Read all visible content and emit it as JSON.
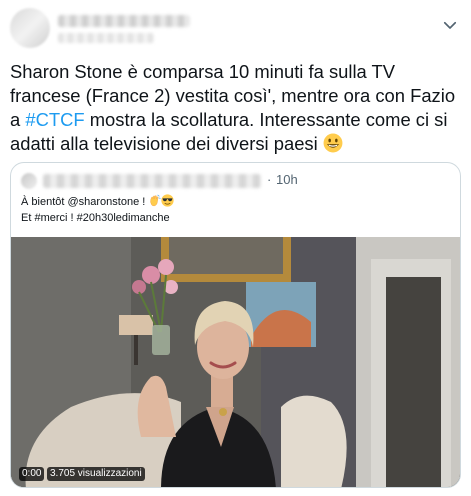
{
  "tweet": {
    "text_1": "Sharon Stone è comparsa 10 minuti fa sulla TV francese (France 2) vestita così', mentre ora con Fazio a ",
    "hashtag": "#CTCF",
    "text_2": " mostra la scollatura. Interessante come ci si adatti alla televisione dei diversi paesi ",
    "emoji": "grinning-face-icon",
    "more_icon": "chevron-down-icon"
  },
  "quote": {
    "separator": "·",
    "time": "10h",
    "line_1": "À bientôt @sharonstone ! ",
    "line_1_emojis": [
      "waving-hand-icon",
      "smiling-face-with-sunglasses-icon"
    ],
    "line_2": "Et #merci ! #20h30ledimanche"
  },
  "video": {
    "elapsed": "0:00",
    "views": "3.705 visualizzazioni"
  },
  "colors": {
    "text": "#0f1419",
    "secondary": "#536471",
    "link": "#1d9bf0",
    "border": "#cfd9de"
  }
}
